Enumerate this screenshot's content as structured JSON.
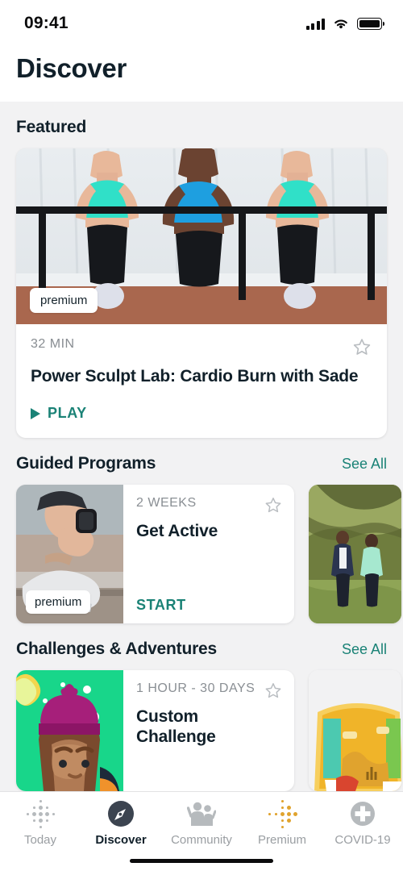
{
  "status_bar": {
    "time": "09:41",
    "cellular_icon": "signal-bars-icon",
    "wifi_icon": "wifi-icon",
    "battery_icon": "battery-full-icon"
  },
  "header": {
    "title": "Discover"
  },
  "sections": [
    {
      "id": "featured",
      "title": "Featured",
      "see_all": null,
      "featured_card": {
        "badge": "premium",
        "duration": "32 MIN",
        "title": "Power Sculpt Lab: Cardio Burn with Sade",
        "action": "PLAY",
        "favorite_icon": "star-outline-icon",
        "play_icon": "play-triangle-icon"
      }
    },
    {
      "id": "guided-programs",
      "title": "Guided Programs",
      "see_all": "See All",
      "cards": [
        {
          "badge": "premium",
          "duration": "2 WEEKS",
          "title": "Get Active",
          "action": "START",
          "favorite_icon": "star-outline-icon"
        }
      ]
    },
    {
      "id": "challenges-adventures",
      "title": "Challenges & Adventures",
      "see_all": "See All",
      "cards": [
        {
          "duration": "1 HOUR - 30 DAYS",
          "title_line1": "Custom",
          "title_line2": "Challenge",
          "favorite_icon": "star-outline-icon"
        }
      ]
    }
  ],
  "tab_bar": {
    "items": [
      {
        "label": "Today",
        "icon": "dot-grid-icon",
        "active": false
      },
      {
        "label": "Discover",
        "icon": "compass-icon",
        "active": true
      },
      {
        "label": "Community",
        "icon": "people-icon",
        "active": false
      },
      {
        "label": "Premium",
        "icon": "gold-dots-icon",
        "active": false
      },
      {
        "label": "COVID-19",
        "icon": "medical-plus-icon",
        "active": false
      }
    ]
  },
  "colors": {
    "accent_teal": "#1a8276",
    "text_dark": "#11202a",
    "text_muted": "#8a8f94",
    "page_bg": "#f2f2f3",
    "card_bg": "#ffffff",
    "tab_inactive": "#9a9ea2",
    "premium_gold": "#e0a32e"
  }
}
